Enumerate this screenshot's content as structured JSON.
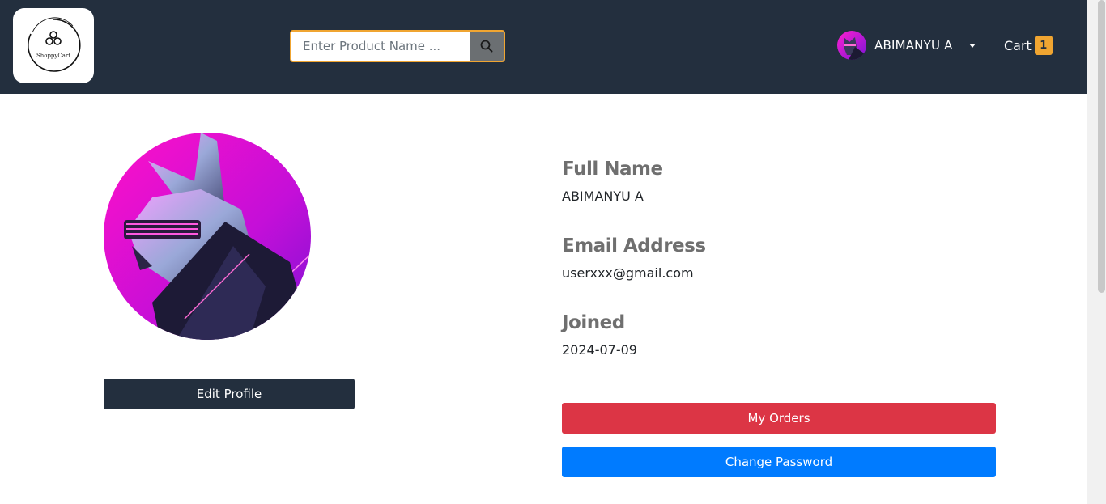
{
  "header": {
    "logo_text": "ShoppyCart",
    "search": {
      "placeholder": "Enter Product Name ...",
      "value": "",
      "button_icon": "search-icon"
    },
    "user": {
      "name": "ABIMANYU A",
      "dropdown_icon": "caret-down-icon"
    },
    "cart": {
      "label": "Cart",
      "count": "1"
    }
  },
  "profile": {
    "edit_button": "Edit Profile",
    "fields": [
      {
        "label": "Full Name",
        "value": "ABIMANYU A"
      },
      {
        "label": "Email Address",
        "value": "userxxx@gmail.com"
      },
      {
        "label": "Joined",
        "value": "2024-07-09"
      }
    ],
    "my_orders_button": "My Orders",
    "change_password_button": "Change Password"
  },
  "colors": {
    "navbar": "#232f3e",
    "accent": "#f0a531",
    "danger": "#dc3545",
    "primary": "#007bff"
  }
}
